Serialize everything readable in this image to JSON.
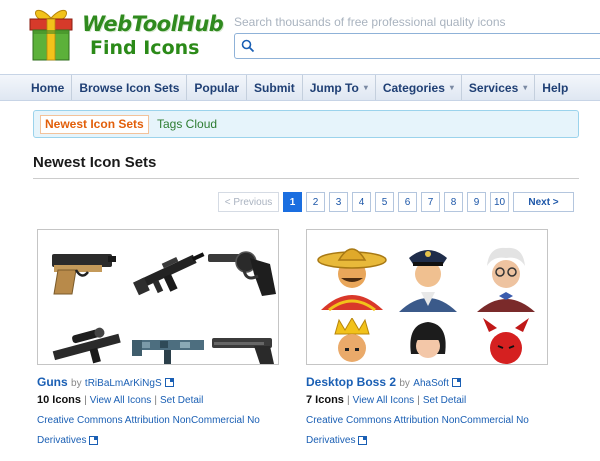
{
  "logo": {
    "title": "WebToolHub",
    "subtitle": "Find Icons",
    "icon": "gift-box-icon"
  },
  "search": {
    "caption": "Search thousands of free professional quality icons",
    "placeholder": "",
    "value": "",
    "icon": "search-icon"
  },
  "nav": {
    "items": [
      {
        "label": "Home",
        "dropdown": false
      },
      {
        "label": "Browse Icon Sets",
        "dropdown": false
      },
      {
        "label": "Popular",
        "dropdown": false
      },
      {
        "label": "Submit",
        "dropdown": false
      },
      {
        "label": "Jump To",
        "dropdown": true
      },
      {
        "label": "Categories",
        "dropdown": true
      },
      {
        "label": "Services",
        "dropdown": true
      },
      {
        "label": "Help",
        "dropdown": false
      }
    ],
    "caret": "▾"
  },
  "subtabs": {
    "active": "Newest Icon Sets",
    "other": "Tags Cloud"
  },
  "section": {
    "title": "Newest Icon Sets"
  },
  "pagination": {
    "prev": "< Previous",
    "pages": [
      "1",
      "2",
      "3",
      "4",
      "5",
      "6",
      "7",
      "8",
      "9",
      "10"
    ],
    "current": "1",
    "next": "Next >"
  },
  "cards": [
    {
      "name": "Guns",
      "by": "by",
      "author": "tRiBaLmArKiNgS",
      "count": "10 Icons",
      "view_all": "View All Icons",
      "set_detail": "Set Detail",
      "separator": "|",
      "license_line1": "Creative Commons Attribution NonCommercial No",
      "license_line2": "Derivatives",
      "preview_icons": [
        "pistol-icon",
        "assault-rifle-icon",
        "revolver-icon",
        "scoped-rifle-icon",
        "camo-rifle-icon",
        "handgun-icon"
      ]
    },
    {
      "name": "Desktop Boss 2",
      "by": "by",
      "author": "AhaSoft",
      "count": "7 Icons",
      "view_all": "View All Icons",
      "set_detail": "Set Detail",
      "separator": "|",
      "license_line1": "Creative Commons Attribution NonCommercial No",
      "license_line2": "Derivatives",
      "preview_icons": [
        "sombrero-man-icon",
        "police-officer-icon",
        "professor-icon",
        "king-icon",
        "woman-icon",
        "devil-icon"
      ]
    }
  ],
  "colors": {
    "accent": "#1a6ee0",
    "link": "#1a5fb4",
    "tab_active": "#e25f0a",
    "brand_green": "#2f8a1e",
    "nav_text": "#1f3f74"
  }
}
